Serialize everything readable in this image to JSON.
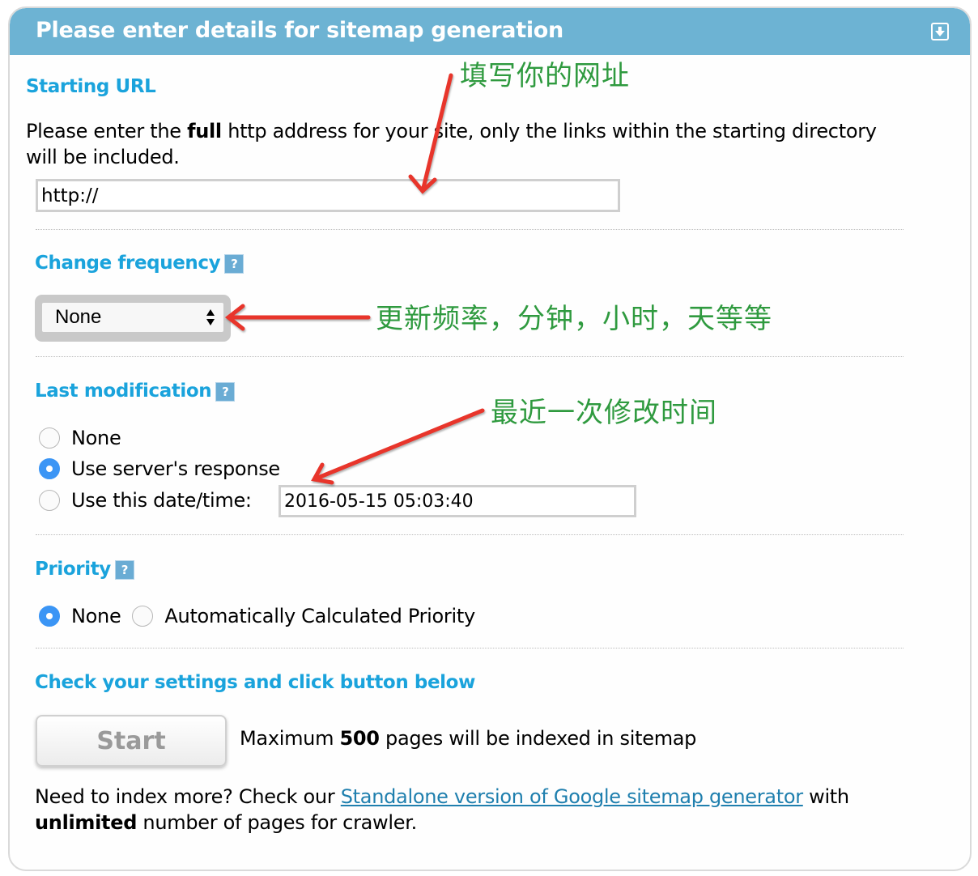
{
  "panel": {
    "title": "Please enter details for sitemap generation",
    "collapse_icon": "download-arrow-icon"
  },
  "starting_url": {
    "heading": "Starting URL",
    "desc_pre": "Please enter the ",
    "desc_bold": "full",
    "desc_post": " http address for your site, only the links within the starting directory will be included.",
    "value": "http://"
  },
  "change_frequency": {
    "heading": "Change frequency",
    "help_icon": "?",
    "selected": "None"
  },
  "last_modification": {
    "heading": "Last modification",
    "help_icon": "?",
    "options": [
      {
        "label": "None",
        "checked": false
      },
      {
        "label": "Use server's response",
        "checked": true
      },
      {
        "label": "Use this date/time:",
        "checked": false
      }
    ],
    "datetime_value": "2016-05-15 05:03:40"
  },
  "priority": {
    "heading": "Priority",
    "help_icon": "?",
    "options": [
      {
        "label": "None",
        "checked": true
      },
      {
        "label": "Automatically Calculated Priority",
        "checked": false
      }
    ]
  },
  "submit": {
    "heading": "Check your settings and click button below",
    "button_label": "Start",
    "max_pre": "Maximum ",
    "max_count": "500",
    "max_post": " pages will be indexed in sitemap"
  },
  "footer": {
    "pre": "Need to index more? Check our ",
    "link": "Standalone version of Google sitemap generator",
    "mid": " with ",
    "bold": "unlimited",
    "post": " number of pages for crawler."
  },
  "annotations": {
    "url": "填写你的网址",
    "frequency": "更新频率，分钟，小时，天等等",
    "lastmod": "最近一次修改时间",
    "arrow_color": "#e8352b",
    "text_color": "#2f9a3f"
  }
}
